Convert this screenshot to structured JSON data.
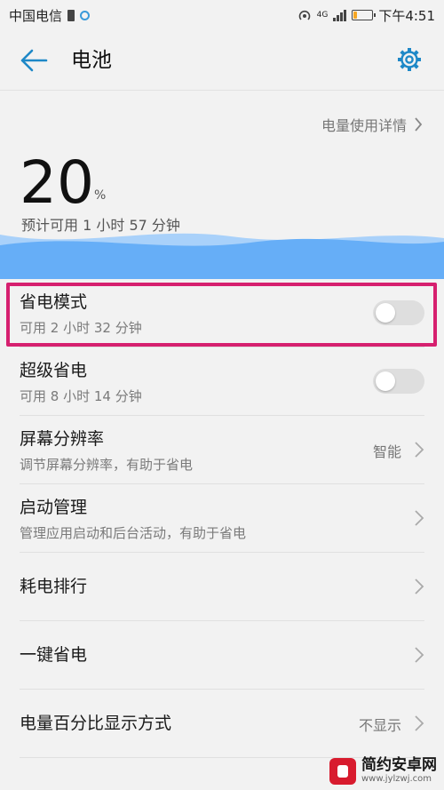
{
  "status_bar": {
    "carrier": "中国电信",
    "network_type": "4G",
    "time": "下午4:51",
    "battery_level_fraction": 0.2
  },
  "header": {
    "title": "电池",
    "back_icon": "arrow-left-icon",
    "settings_icon": "gear-icon"
  },
  "battery": {
    "usage_details_link": "电量使用详情",
    "percent_value": "20",
    "percent_unit": "%",
    "estimate": "预计可用 1 小时 57 分钟"
  },
  "settings_list": [
    {
      "title": "省电模式",
      "subtitle": "可用 2 小时 32 分钟",
      "control": "toggle",
      "on": false
    },
    {
      "title": "超级省电",
      "subtitle": "可用 8 小时 14 分钟",
      "control": "toggle",
      "on": false
    },
    {
      "title": "屏幕分辨率",
      "subtitle": "调节屏幕分辨率，有助于省电",
      "value": "智能",
      "control": "chevron"
    },
    {
      "title": "启动管理",
      "subtitle": "管理应用启动和后台活动，有助于省电",
      "control": "chevron"
    },
    {
      "title": "耗电排行",
      "control": "chevron"
    },
    {
      "title": "一键省电",
      "control": "chevron"
    },
    {
      "title": "电量百分比显示方式",
      "value": "不显示",
      "control": "chevron"
    }
  ],
  "colors": {
    "accent": "#1e88c7",
    "highlight_border": "#d6206f",
    "wave_dark": "#66aef7",
    "wave_light": "#a9d1fa",
    "toggle_off": "#dedede"
  },
  "watermark": {
    "name": "简约安卓网",
    "url": "www.jylzwj.com"
  }
}
